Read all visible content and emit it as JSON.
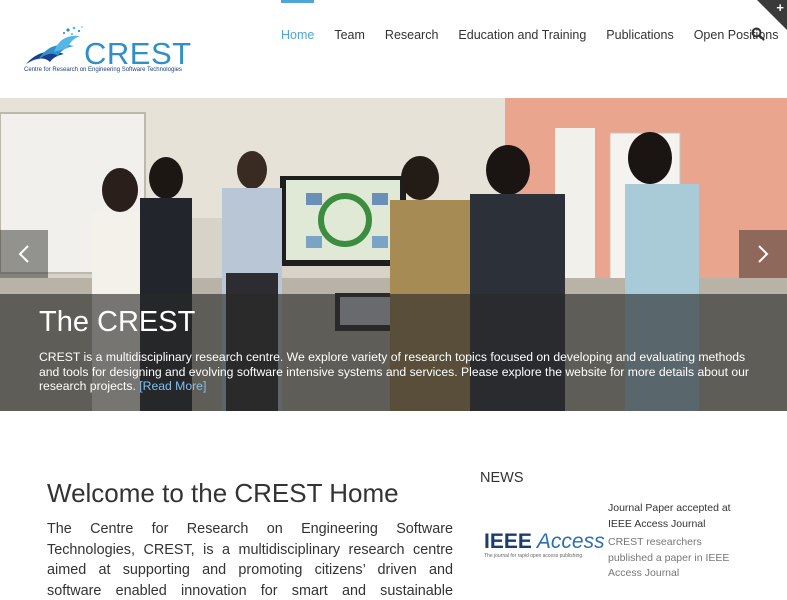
{
  "header": {
    "logo": {
      "wordmark": "CREST",
      "tagline": "Centre for Research on Engineering Software Technologies"
    },
    "nav": {
      "items": [
        {
          "label": "Home",
          "active": true
        },
        {
          "label": "Team",
          "active": false
        },
        {
          "label": "Research",
          "active": false
        },
        {
          "label": "Education and Training",
          "active": false
        },
        {
          "label": "Publications",
          "active": false
        },
        {
          "label": "Open Positions",
          "active": false
        }
      ],
      "search_icon": "search-icon"
    },
    "corner_toggle_icon": "plus-icon"
  },
  "slider": {
    "title": "The CREST",
    "text": "CREST is a multidisciplinary research centre. We explore variety of research topics focused on developing and evaluating methods and tools for designing and evolving software intensive systems and services. Please explore the website for more details about our research projects.",
    "read_more": "[Read More]",
    "prev_icon": "chevron-left-icon",
    "next_icon": "chevron-right-icon"
  },
  "welcome": {
    "title": "Welcome to the CREST Home",
    "body": "The Centre for Research on Engineering Software Technologies, CREST, is a multidisciplinary research centre aimed at supporting and promoting citizens’ driven and software enabled innovation for smart and sustainable societies. To achieve that"
  },
  "news": {
    "heading": "NEWS",
    "items": [
      {
        "thumb_brand": "IEEE",
        "thumb_name": "Access",
        "thumb_sub": "The journal for rapid open access publishing",
        "title": "Journal Paper accepted at IEEE Access Journal",
        "excerpt": "CREST researchers published a paper in IEEE Access Journal"
      }
    ]
  },
  "colors": {
    "accent": "#4fa5d8",
    "logo_blue": "#2f8fc9",
    "caption_bg": "rgba(40,40,40,0.62)"
  }
}
